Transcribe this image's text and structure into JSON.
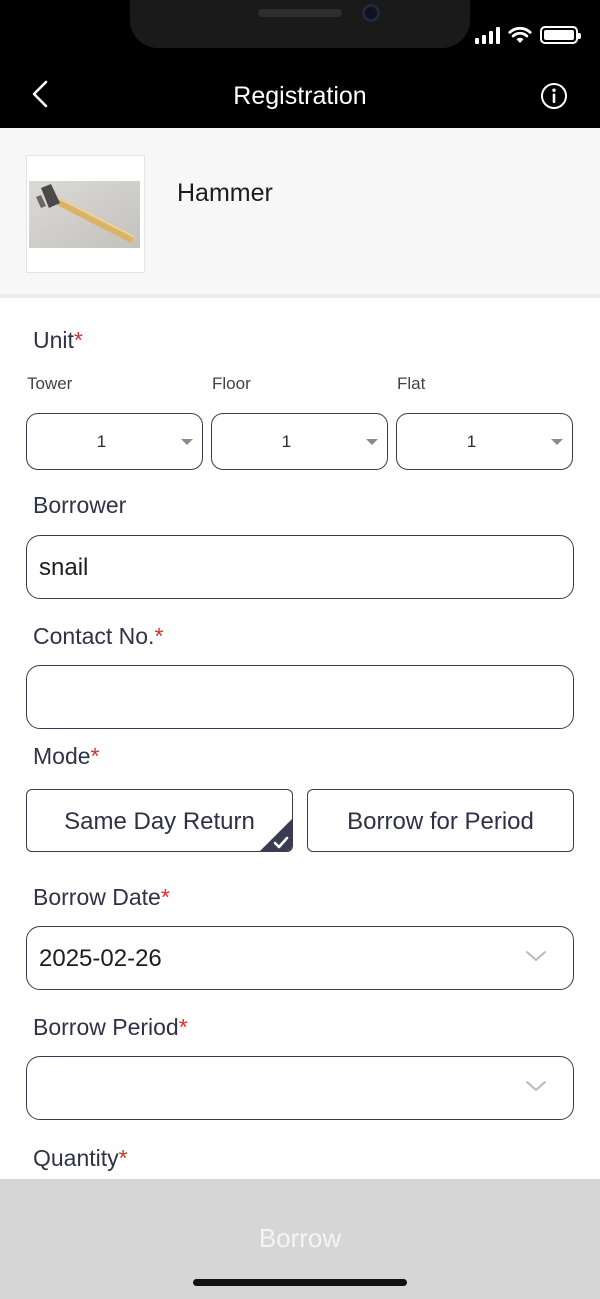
{
  "nav": {
    "title": "Registration",
    "back_icon": "chevron-left-icon",
    "info_icon": "info-circle-icon"
  },
  "item": {
    "name": "Hammer",
    "image": "hammer-photo"
  },
  "form": {
    "unit": {
      "label": "Unit",
      "required_mark": "*",
      "tower": {
        "label": "Tower",
        "value": "1"
      },
      "floor": {
        "label": "Floor",
        "value": "1"
      },
      "flat": {
        "label": "Flat",
        "value": "1"
      }
    },
    "borrower": {
      "label": "Borrower",
      "value": "snail"
    },
    "contact": {
      "label": "Contact No.",
      "required_mark": "*",
      "value": ""
    },
    "mode": {
      "label": "Mode",
      "required_mark": "*",
      "options": [
        "Same Day Return",
        "Borrow for Period"
      ],
      "selected": "Same Day Return"
    },
    "borrow_date": {
      "label": "Borrow Date",
      "required_mark": "*",
      "value": "2025-02-26"
    },
    "borrow_period": {
      "label": "Borrow Period",
      "required_mark": "*",
      "value": ""
    },
    "quantity": {
      "label": "Quantity",
      "required_mark": "*"
    }
  },
  "footer": {
    "borrow_label": "Borrow"
  },
  "colors": {
    "header_bg": "#000000",
    "required": "#d3302c",
    "border": "#3a3b4e",
    "selected_check": "#3a3b4e",
    "footer_bg": "#d6d6d6"
  }
}
